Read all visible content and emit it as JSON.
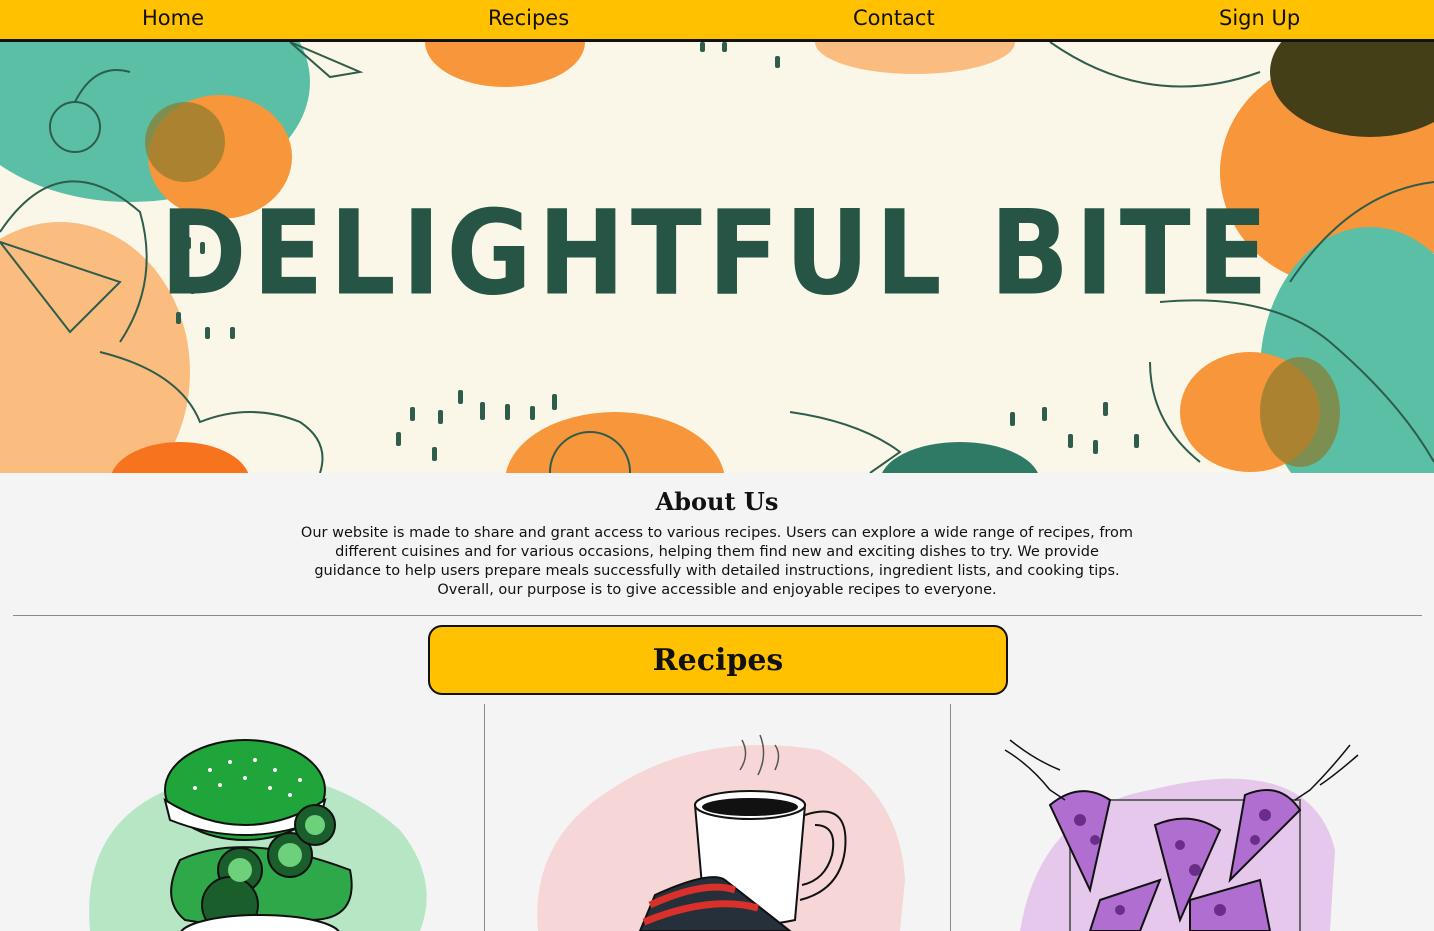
{
  "nav": {
    "items": [
      {
        "label": "Home"
      },
      {
        "label": "Recipes"
      },
      {
        "label": "Contact"
      },
      {
        "label": "Sign Up"
      }
    ]
  },
  "hero": {
    "title": "DELIGHTFUL BITE"
  },
  "about": {
    "title": "About Us",
    "lines": [
      "Our website is made to share and grant access to various recipes. Users can explore a wide range of recipes, from",
      "different cuisines and for various occasions, helping them find new and exciting dishes to try. We provide",
      "guidance to help users prepare meals successfully with detailed instructions, ingredient lists, and cooking tips.",
      "Overall, our purpose is to give accessible and enjoyable recipes to everyone."
    ]
  },
  "recipes": {
    "button_label": "Recipes",
    "cards": [
      {
        "image": "burger-illustration",
        "bg_color": "#b6e6c4"
      },
      {
        "image": "coffee-cake-illustration",
        "bg_color": "#f6d6d6"
      },
      {
        "image": "pizza-illustration",
        "bg_color": "#e6c8ec"
      }
    ]
  },
  "colors": {
    "accent": "#ffc100",
    "hero_bg": "#fbf7e8",
    "title_green": "#265545",
    "orange": "#f7963a",
    "teal": "#5bbfa6"
  }
}
